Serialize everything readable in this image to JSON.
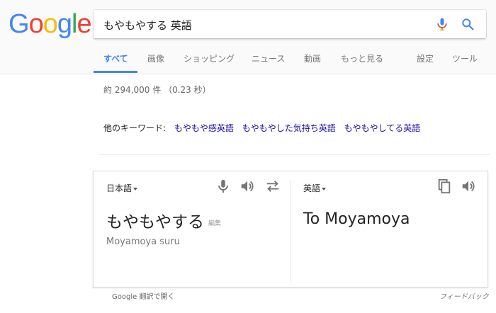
{
  "logo": {
    "text": "Google"
  },
  "search": {
    "query": "もやもやする 英語"
  },
  "tabs": [
    {
      "label": "すべて"
    },
    {
      "label": "画像"
    },
    {
      "label": "ショッピング"
    },
    {
      "label": "ニュース"
    },
    {
      "label": "動画"
    },
    {
      "label": "もっと見る"
    },
    {
      "label": "設定"
    },
    {
      "label": "ツール"
    }
  ],
  "results": {
    "count_text": "約 294,000 件 （0.23 秒）"
  },
  "related": {
    "label": "他のキーワード:",
    "links": [
      "もやもや感英語",
      "もやもやした気持ち英語",
      "もやもやしてる英語"
    ]
  },
  "translate": {
    "source_lang": "日本語",
    "target_lang": "英語",
    "source_text": "もやもやする",
    "edit_label": "編集",
    "romanization": "Moyamoya suru",
    "target_text": "To Moyamoya"
  },
  "footer": {
    "open_in_translate": "Google 翻訳で開く",
    "feedback": "フィードバック"
  },
  "colors": {
    "google_blue": "#4285f4",
    "google_red": "#ea4335",
    "google_yellow": "#fbbc05",
    "google_green": "#34a853",
    "link": "#1a0dab"
  }
}
